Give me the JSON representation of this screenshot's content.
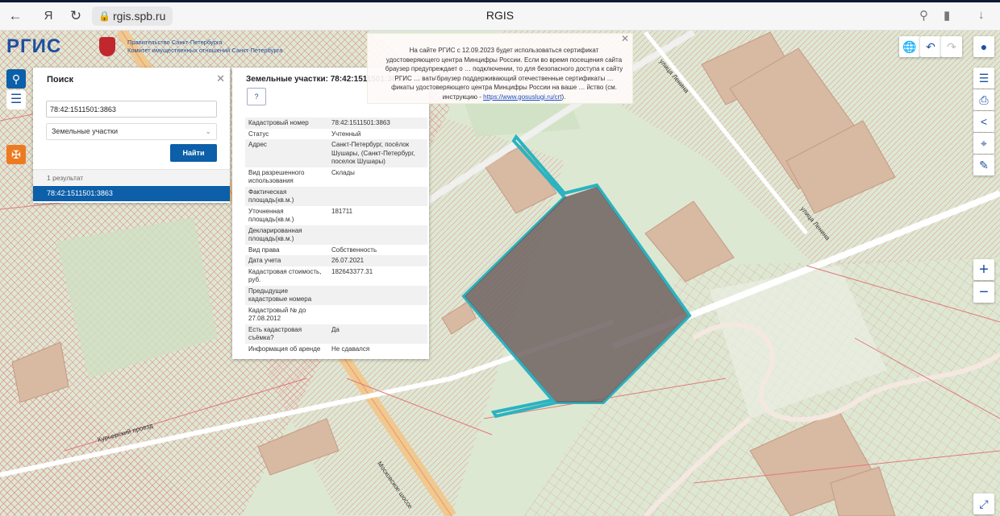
{
  "browser": {
    "back_icon": "arrow-left-icon",
    "yandex_icon": "Я",
    "url": "rgis.spb.ru",
    "tab_title": "RGIS"
  },
  "logo": {
    "name": "РГИС",
    "gov_line1": "Правительство Санкт-Петербурга",
    "gov_line2": "Комитет имущественных отношений Санкт-Петербурга"
  },
  "search": {
    "title": "Поиск",
    "query": "78:42:1511501:3863",
    "layer": "Земельные участки",
    "find_label": "Найти",
    "result_count": "1 результат",
    "results": [
      "78:42:1511501:3863"
    ]
  },
  "info": {
    "title": "Земельные участки: 78:42:1511501:3863",
    "help_label": "?",
    "rows": [
      {
        "key": "Кадастровый номер",
        "value": "78:42:1511501:3863"
      },
      {
        "key": "Статус",
        "value": "Учтенный"
      },
      {
        "key": "Адрес",
        "value": "Санкт-Петербург, посёлок Шушары, (Санкт-Петербург, поселок Шушары)"
      },
      {
        "key": "Вид разрешенного использования",
        "value": "Склады"
      },
      {
        "key": "Фактическая площадь(кв.м.)",
        "value": ""
      },
      {
        "key": "Уточненная площадь(кв.м.)",
        "value": "181711"
      },
      {
        "key": "Декларированная площадь(кв.м.)",
        "value": ""
      },
      {
        "key": "Вид права",
        "value": "Собственность"
      },
      {
        "key": "Дата учета",
        "value": "26.07.2021"
      },
      {
        "key": "Кадастровая стоимость, руб.",
        "value": "182643377.31"
      },
      {
        "key": "Предыдущие кадастровые номера",
        "value": ""
      },
      {
        "key": "Кадастровый № до 27.08.2012",
        "value": ""
      },
      {
        "key": "Есть кадастровая съёмка?",
        "value": "Да"
      },
      {
        "key": "Информация об аренде",
        "value": "Не сдавался"
      }
    ]
  },
  "notice": {
    "text": "На сайте РГИС с 12.09.2023 будет использоваться сертификат удостоверяющего центра Минцифры России. Если во время посещения сайта браузер предупреждает о … подключении, то для безопасного доступа к сайту РГИС … вать браузер поддерживающий отечественные сертификаты … фикаты удостоверяющего центра Минцифры России на ваше … йство (см. инструкцию -",
    "link": "https://www.gosuslugi.ru/crt",
    "tail": ")."
  },
  "streets": {
    "lenina_1": "улица Ленина",
    "lenina_2": "улица Ленина",
    "kurier": "Курьерский проезд",
    "moskovskoe": "Московское шоссе"
  },
  "colors": {
    "map_bg": "#dfe9d6",
    "parcel_red": "#e07a7a",
    "highlight": "#2bb3c0",
    "selected_fill": "#6e6260",
    "accent_blue": "#0c5fa8"
  },
  "icons": {
    "reload": "reload-icon",
    "search_tool": "search-icon",
    "menu_tool": "menu-icon",
    "emblem_tool": "spb-emblem-icon",
    "globe": "globe-icon",
    "undo": "undo-icon",
    "redo": "redo-icon",
    "user": "user-icon",
    "layers": "layers-icon",
    "print": "print-icon",
    "share": "share-icon",
    "identify": "identify-icon",
    "measure": "measure-icon",
    "zoom_in": "plus-icon",
    "zoom_out": "minus-icon",
    "fullscreen": "fullscreen-icon"
  }
}
